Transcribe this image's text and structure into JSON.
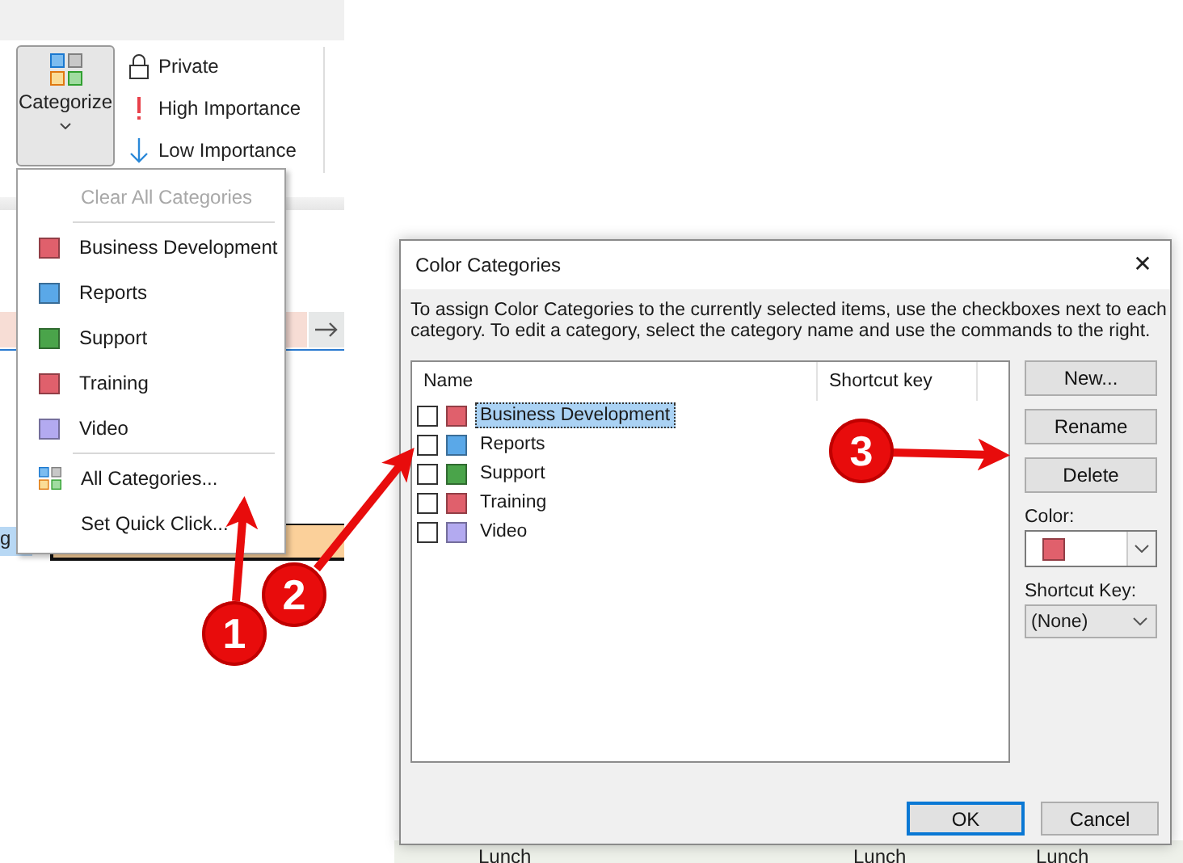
{
  "ribbon": {
    "categorize_button": {
      "label": "Categorize"
    },
    "tags": [
      {
        "kind": "lock",
        "label": "Private"
      },
      {
        "kind": "high",
        "label": "High Importance"
      },
      {
        "kind": "low",
        "label": "Low Importance"
      }
    ]
  },
  "background_calendar": {
    "texts": [
      {
        "text": "g"
      },
      {
        "text": "Lunch"
      },
      {
        "text": "Lunch"
      },
      {
        "text": "Lunch"
      }
    ]
  },
  "categorize_menu": {
    "items": [
      {
        "kind": "command",
        "label": "Clear All Categories",
        "disabled": true
      },
      {
        "kind": "separator"
      },
      {
        "kind": "category",
        "label": "Business Development",
        "color": "#e0606c"
      },
      {
        "kind": "category",
        "label": "Reports",
        "color": "#5aa8e8"
      },
      {
        "kind": "category",
        "label": "Support",
        "color": "#4aa44a"
      },
      {
        "kind": "category",
        "label": "Training",
        "color": "#e0606c"
      },
      {
        "kind": "category",
        "label": "Video",
        "color": "#b3aaf0"
      },
      {
        "kind": "separator"
      },
      {
        "kind": "all",
        "label": "All Categories...",
        "disabled": false
      },
      {
        "kind": "command",
        "label": "Set Quick Click...",
        "disabled": false
      }
    ]
  },
  "dialog": {
    "title": "Color Categories",
    "close": "✕",
    "description": "To assign Color Categories to the currently selected items, use the checkboxes next to each category.  To edit a category, select the category name and use the commands to the right.",
    "columns": [
      "Name",
      "Shortcut key"
    ],
    "rows": [
      {
        "name": "Business Development",
        "color": "#e0606c",
        "checked": false,
        "selected": true
      },
      {
        "name": "Reports",
        "color": "#5aa8e8",
        "checked": false,
        "selected": false
      },
      {
        "name": "Support",
        "color": "#4aa44a",
        "checked": false,
        "selected": false
      },
      {
        "name": "Training",
        "color": "#e0606c",
        "checked": false,
        "selected": false
      },
      {
        "name": "Video",
        "color": "#b3aaf0",
        "checked": false,
        "selected": false
      }
    ],
    "side_buttons": [
      "New...",
      "Rename",
      "Delete"
    ],
    "color_field": {
      "label": "Color:",
      "color": "#e0606c"
    },
    "shortcut_field": {
      "label": "Shortcut Key:",
      "value": "(None)"
    },
    "footer_buttons": [
      {
        "label": "OK",
        "default": true
      },
      {
        "label": "Cancel",
        "default": false
      }
    ]
  },
  "annotations": [
    {
      "label": "1"
    },
    {
      "label": "2"
    },
    {
      "label": "3"
    }
  ]
}
